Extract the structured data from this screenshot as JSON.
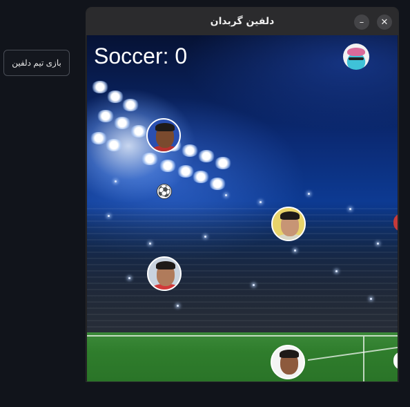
{
  "launcher": {
    "button_label": "بازی تیم دلفین"
  },
  "window": {
    "title": "دلفین گربدان",
    "minimize_symbol": "–",
    "close_symbol": "✕"
  },
  "game": {
    "score_text": "Soccer: 0",
    "logo_icon": "dolphin-team-logo",
    "ball_icon": "soccer-ball-icon",
    "ball_glyph": "⚽",
    "players": [
      {
        "name": "player-avatar-1",
        "shirt": "#b8312f",
        "skin": "#7a4a2e"
      },
      {
        "name": "player-avatar-2",
        "shirt": "#d8d8c8",
        "skin": "#c79575"
      },
      {
        "name": "player-avatar-3",
        "shirt": "#d23a3a",
        "skin": "#b07b5b"
      },
      {
        "name": "player-avatar-4",
        "shirt": "#f2f2f2",
        "skin": "#8d5a3d"
      }
    ]
  }
}
